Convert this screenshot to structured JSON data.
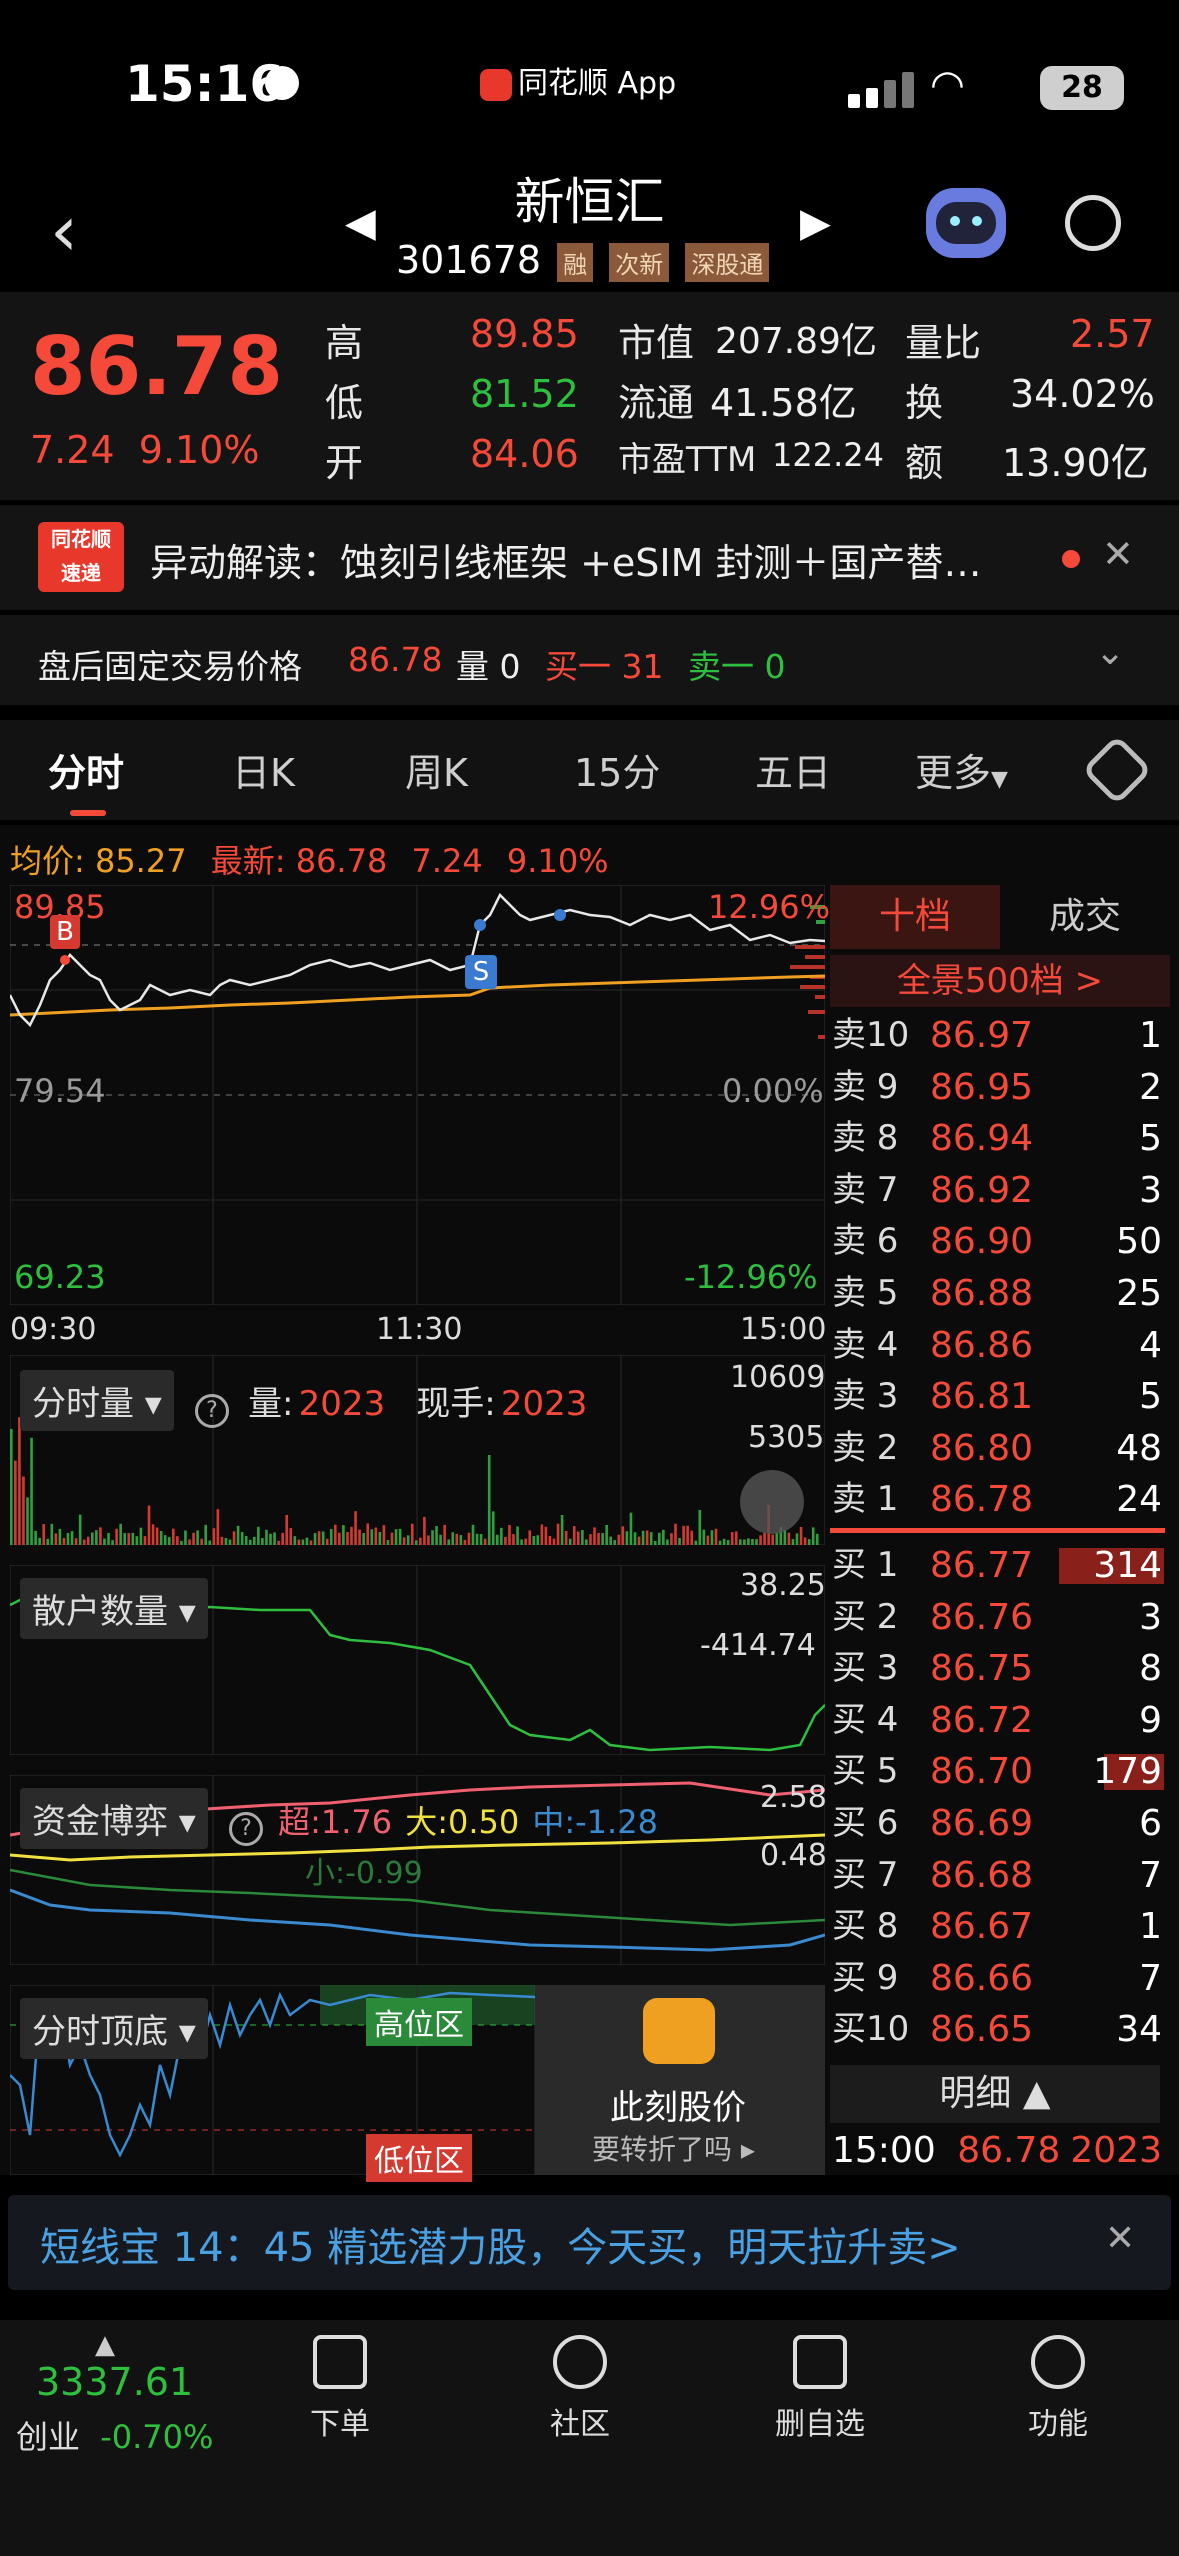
{
  "status": {
    "time": "15:16",
    "app": "同花顺 App",
    "battery": "28"
  },
  "nav": {
    "name": "新恒汇",
    "code": "301678",
    "tags": [
      "融",
      "次新",
      "深股通"
    ]
  },
  "quote": {
    "price": "86.78",
    "change": "7.24",
    "change_pct": "9.10%",
    "high_label": "高",
    "high": "89.85",
    "low_label": "低",
    "low": "81.52",
    "open_label": "开",
    "open": "84.06",
    "mcap_label": "市值",
    "mcap": "207.89亿",
    "float_label": "流通",
    "float": "41.58亿",
    "pe_label": "市盈TTM",
    "pe": "122.24",
    "vr_label": "量比",
    "vr": "2.57",
    "turn_label": "换",
    "turn": "34.02%",
    "amt_label": "额",
    "amt": "13.90亿"
  },
  "news": {
    "brand": "同花顺 速递",
    "text": "异动解读：蚀刻引线框架 +eSIM 封测＋国产替…"
  },
  "post": {
    "label": "盘后固定交易价格",
    "price": "86.78",
    "vol": "量 0",
    "buy1": "买一 31",
    "sell1": "卖一 0"
  },
  "tabs": [
    "分时",
    "日K",
    "周K",
    "15分",
    "五日",
    "更多"
  ],
  "info_line": {
    "avg": "均价: 85.27",
    "latest": "最新: 86.78",
    "chg": "7.24",
    "pct": "9.10%"
  },
  "chart": {
    "ymax": "89.85",
    "ymid": "79.54",
    "ymin": "69.23",
    "pmax": "12.96%",
    "pmid": "0.00%",
    "pmin": "-12.96%",
    "x0": "09:30",
    "x1": "11:30",
    "x2": "15:00",
    "b_marker": "B",
    "s_marker": "S"
  },
  "vol_panel": {
    "title": "分时量",
    "vol_label": "量:",
    "vol": "2023",
    "hand_label": "现手:",
    "hand": "2023",
    "top": "10609",
    "mid": "5305"
  },
  "retail_panel": {
    "title": "散户数量",
    "top": "38.25",
    "bottom": "-414.74"
  },
  "fund_panel": {
    "title": "资金博弈",
    "super": "超:1.76",
    "big": "大:0.50",
    "mid": "中:-1.28",
    "small": "小:-0.99",
    "top": "2.58",
    "mid_axis": "0.48"
  },
  "top_bottom_panel": {
    "title": "分时顶底",
    "high_zone": "高位区",
    "low_zone": "低位区",
    "promo_title": "此刻股价",
    "promo_sub": "要转折了吗"
  },
  "orderbook": {
    "tab_ten": "十档",
    "tab_trades": "成交",
    "full": "全景500档 >",
    "sells": [
      {
        "label": "卖10",
        "price": "86.97",
        "vol": "1"
      },
      {
        "label": "卖 9",
        "price": "86.95",
        "vol": "2"
      },
      {
        "label": "卖 8",
        "price": "86.94",
        "vol": "5"
      },
      {
        "label": "卖 7",
        "price": "86.92",
        "vol": "3"
      },
      {
        "label": "卖 6",
        "price": "86.90",
        "vol": "50"
      },
      {
        "label": "卖 5",
        "price": "86.88",
        "vol": "25"
      },
      {
        "label": "卖 4",
        "price": "86.86",
        "vol": "4"
      },
      {
        "label": "卖 3",
        "price": "86.81",
        "vol": "5"
      },
      {
        "label": "卖 2",
        "price": "86.80",
        "vol": "48"
      },
      {
        "label": "卖 1",
        "price": "86.78",
        "vol": "24"
      }
    ],
    "buys": [
      {
        "label": "买 1",
        "price": "86.77",
        "vol": "314"
      },
      {
        "label": "买 2",
        "price": "86.76",
        "vol": "3"
      },
      {
        "label": "买 3",
        "price": "86.75",
        "vol": "8"
      },
      {
        "label": "买 4",
        "price": "86.72",
        "vol": "9"
      },
      {
        "label": "买 5",
        "price": "86.70",
        "vol": "179"
      },
      {
        "label": "买 6",
        "price": "86.69",
        "vol": "6"
      },
      {
        "label": "买 7",
        "price": "86.68",
        "vol": "7"
      },
      {
        "label": "买 8",
        "price": "86.67",
        "vol": "1"
      },
      {
        "label": "买 9",
        "price": "86.66",
        "vol": "7"
      },
      {
        "label": "买10",
        "price": "86.65",
        "vol": "34"
      }
    ],
    "detail_label": "明细",
    "last_trade": {
      "time": "15:00",
      "price": "86.78",
      "vol": "2023"
    }
  },
  "banner": {
    "text": "短线宝 14：45 精选潜力股，今天买，明天拉升卖>"
  },
  "tabbar": {
    "index_value": "3337.61",
    "index_name": "创业",
    "index_pct": "-0.70%",
    "items": [
      "下单",
      "社区",
      "删自选",
      "功能"
    ]
  }
}
